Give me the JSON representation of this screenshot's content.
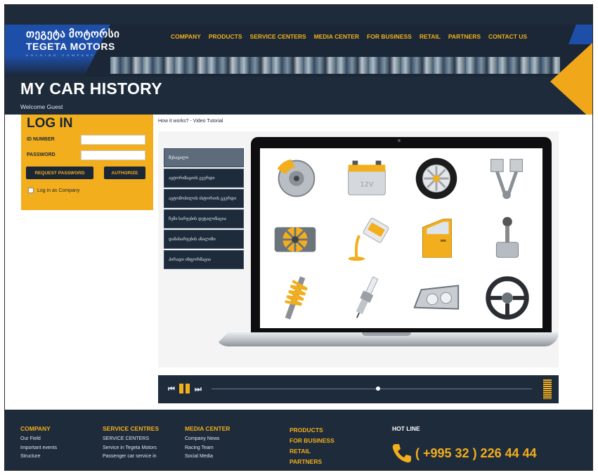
{
  "header": {
    "logo_line1": "თეგეტა მოტორსი",
    "logo_line2": "TEGETA MOTORS",
    "logo_line3": "HOLDING COMPANY",
    "nav": [
      "COMPANY",
      "PRODUCTS",
      "SERVICE CENTERS",
      "MEDIA CENTER",
      "FOR BUSINESS",
      "RETAIL",
      "PARTNERS",
      "CONTACT US"
    ]
  },
  "page": {
    "title": "MY CAR HISTORY",
    "welcome": "Welcome Guest"
  },
  "login": {
    "title": "LOG IN",
    "id_label": "ID NUMBER",
    "id_value": "",
    "password_label": "PASSWORD",
    "password_value": "",
    "request_password": "REQUEST PASSWORD",
    "authorize": "AUTHORIZE",
    "company_checkbox": "Log in as Company",
    "company_checked": false
  },
  "video": {
    "link_text": "How it works? - Video Tutorial",
    "categories": [
      "შესავალი",
      "ავტორიზაციის გვერდი",
      "ავტომობილის ისტორიის გვერდი",
      "ჩემი ხარჯების დეტალიზაცია",
      "დანახარჯების ანალიზი",
      "პირადი ინფორმაცია"
    ],
    "active_category": 0,
    "progress": 0.52,
    "screen_icons": [
      "brake-disc-icon",
      "battery-icon",
      "wheel-icon",
      "pistons-icon",
      "engine-icon",
      "oil-can-icon",
      "car-door-icon",
      "gear-shift-icon",
      "shock-absorber-icon",
      "spark-plug-icon",
      "headlight-icon",
      "steering-wheel-icon"
    ]
  },
  "footer": {
    "company": {
      "heading": "COMPANY",
      "links": [
        "Our Field",
        "Important events",
        "Structure"
      ]
    },
    "service": {
      "heading": "SERVICE CENTRES",
      "links": [
        "SERVICE CENTERS",
        "Service in Tegeta Motors",
        "Passenger car service in"
      ]
    },
    "media": {
      "heading": "MEDIA CENTER",
      "links": [
        "Company News",
        "Racing Team",
        "Social Media"
      ]
    },
    "products": [
      "PRODUCTS",
      "FOR BUSINESS",
      "RETAIL",
      "PARTNERS"
    ],
    "hotline_label": "HOT LINE",
    "phone": "( +995 32 ) 226 44 44"
  },
  "colors": {
    "navy": "#1e2b3b",
    "gold": "#f2ae1c",
    "blue": "#1e4fa8"
  }
}
